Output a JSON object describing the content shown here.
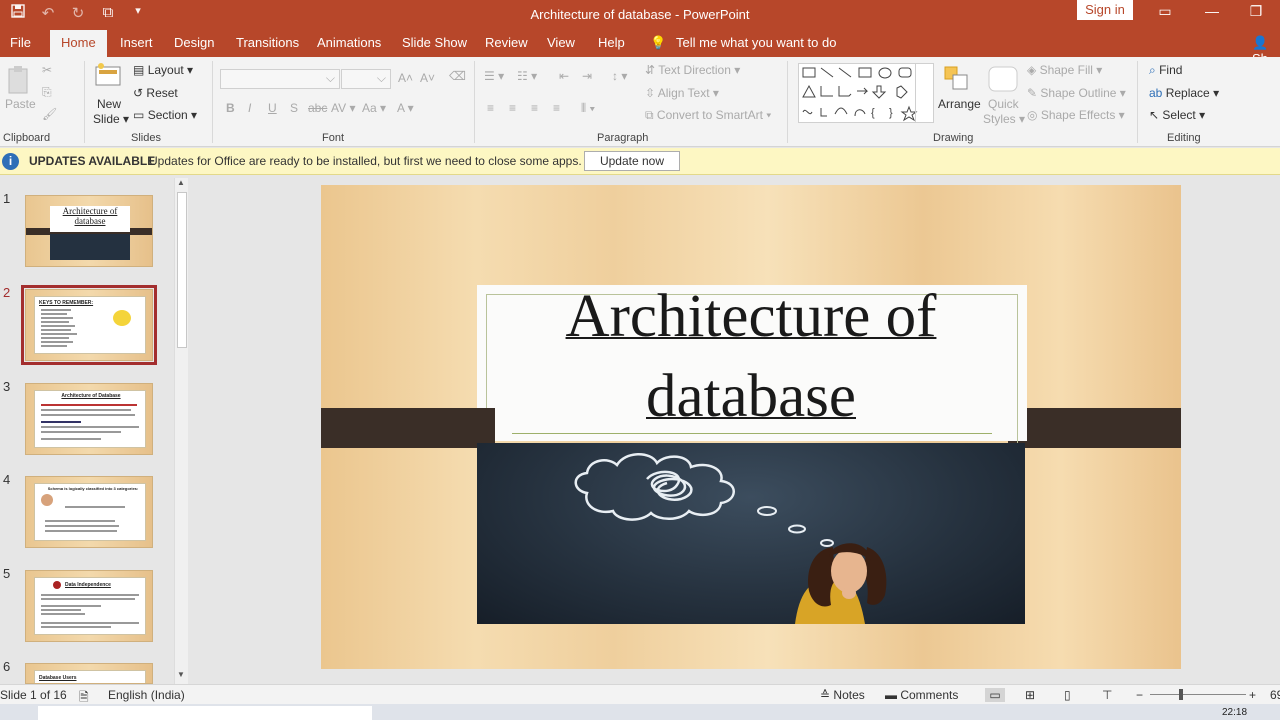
{
  "window": {
    "title": "Architecture of database  -  PowerPoint",
    "signin": "Sign in"
  },
  "tabs": [
    "File",
    "Home",
    "Insert",
    "Design",
    "Transitions",
    "Animations",
    "Slide Show",
    "Review",
    "View",
    "Help"
  ],
  "tell_me": "Tell me what you want to do",
  "share_cut": "Sh",
  "ribbon": {
    "clipboard": {
      "paste": "Paste",
      "label": "Clipboard"
    },
    "slides": {
      "new_slide_1": "New",
      "new_slide_2": "Slide",
      "layout": "Layout",
      "reset": "Reset",
      "section": "Section",
      "label": "Slides"
    },
    "font": {
      "label": "Font",
      "bold": "B",
      "italic": "I",
      "underline": "U",
      "strike": "S",
      "spacing": "abc",
      "case": "Aa"
    },
    "paragraph": {
      "text_direction": "Text Direction",
      "align_text": "Align Text",
      "convert_smartart": "Convert to SmartArt",
      "label": "Paragraph"
    },
    "drawing": {
      "arrange": "Arrange",
      "quick_styles_1": "Quick",
      "quick_styles_2": "Styles",
      "shape_fill": "Shape Fill",
      "shape_outline": "Shape Outline",
      "shape_effects": "Shape Effects",
      "label": "Drawing"
    },
    "editing": {
      "find": "Find",
      "replace": "Replace",
      "select": "Select",
      "label": "Editing"
    }
  },
  "update_bar": {
    "title": "UPDATES AVAILABLE",
    "message": "Updates for Office are ready to be installed, but first we need to close some apps.",
    "button": "Update now"
  },
  "thumbnails": [
    {
      "num": "1",
      "title": "Architecture of database"
    },
    {
      "num": "2",
      "title": "KEYS TO REMEMBER:"
    },
    {
      "num": "3",
      "title": "Architecture of Database"
    },
    {
      "num": "4",
      "title": "Schema is logically classified into 3 categories:"
    },
    {
      "num": "5",
      "title": "Data Independence"
    },
    {
      "num": "6",
      "title": "Database Users"
    }
  ],
  "slide": {
    "title_line1": "Architecture of",
    "title_line2": "database"
  },
  "status": {
    "slide_of": "Slide 1 of 16",
    "language": "English (India)",
    "notes": "Notes",
    "comments": "Comments",
    "zoom": "69"
  },
  "taskbar": {
    "time": "22:18"
  },
  "colors": {
    "accent": "#b7472a",
    "selected_thumb": "#a32e2e"
  }
}
